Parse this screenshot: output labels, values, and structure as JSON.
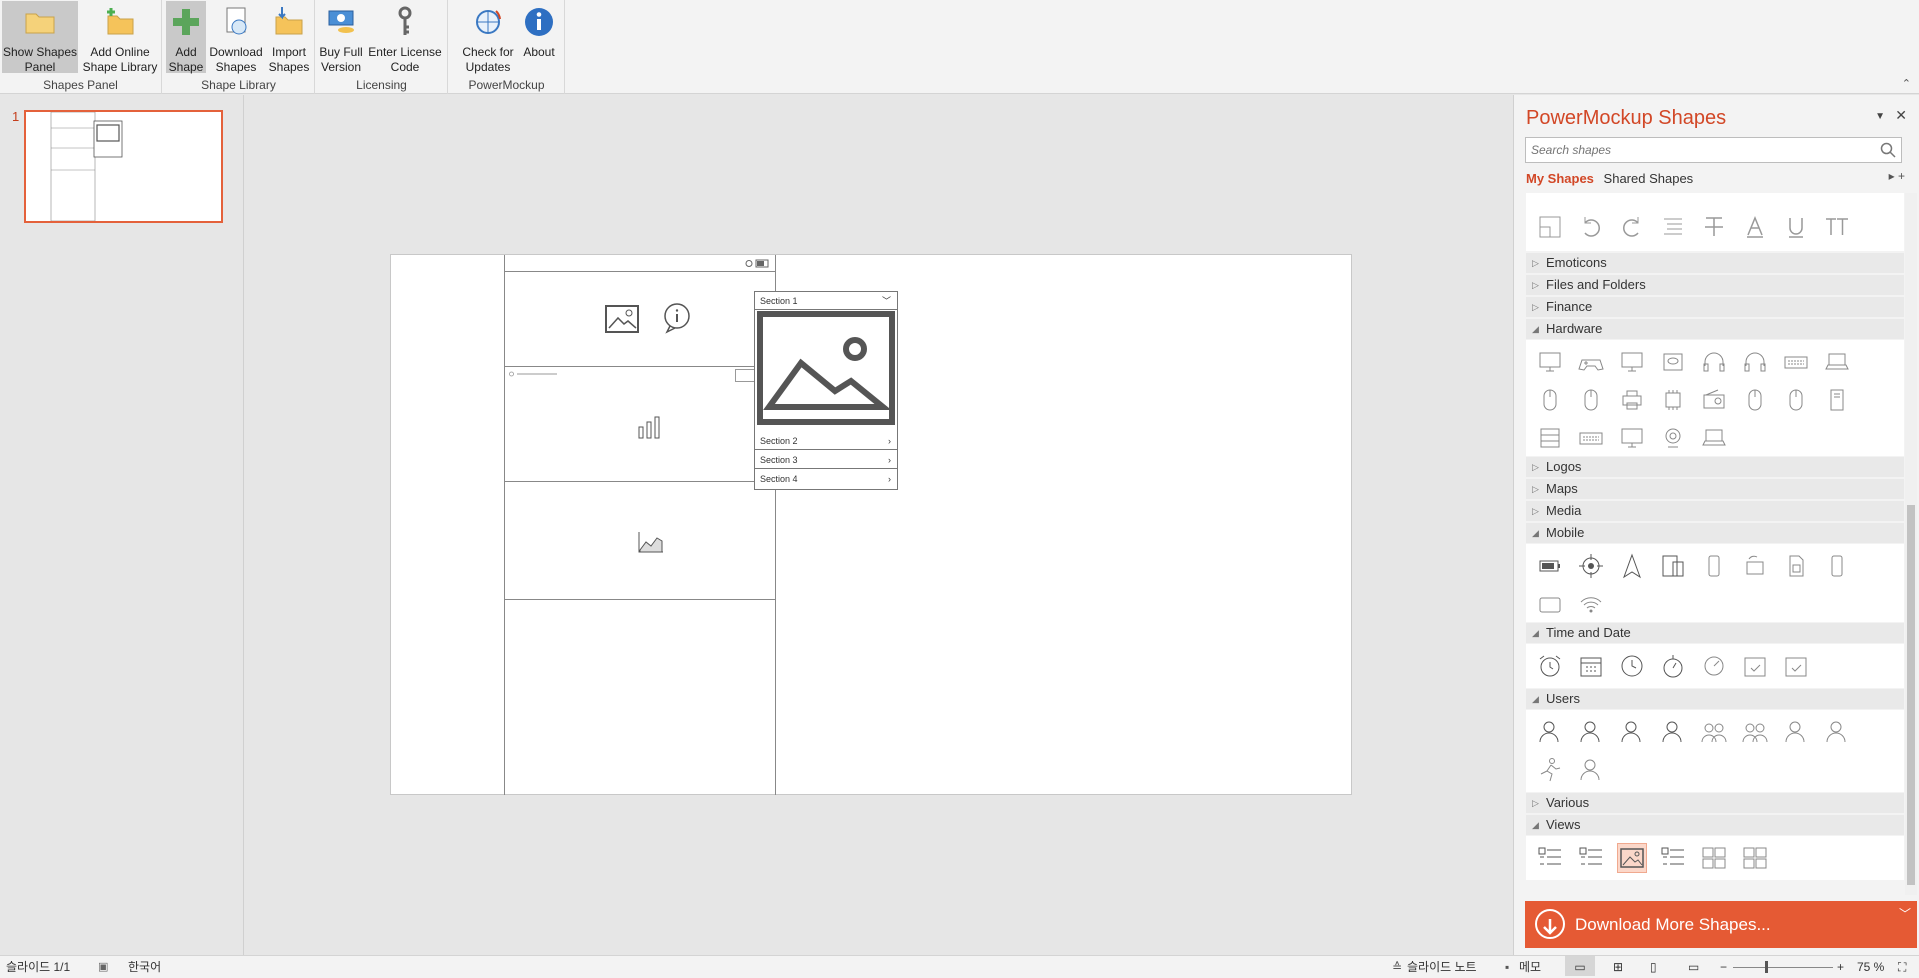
{
  "ribbon": {
    "groups": [
      {
        "label": "Shapes Panel"
      },
      {
        "label": "Shape Library"
      },
      {
        "label": "Licensing"
      },
      {
        "label": "PowerMockup"
      }
    ],
    "buttons": {
      "show_shapes_panel": "Show Shapes Panel",
      "add_online": "Add Online Shape Library",
      "add_shape": "Add Shape",
      "download_shapes": "Download Shapes",
      "import_shapes": "Import Shapes",
      "buy_full": "Buy Full Version",
      "enter_license": "Enter License Code",
      "check_updates": "Check for Updates",
      "about": "About"
    }
  },
  "thumbnails": {
    "number": "1"
  },
  "slide": {
    "accordion": {
      "section1": "Section 1",
      "section2": "Section 2",
      "section3": "Section 3",
      "section4": "Section 4"
    }
  },
  "panel": {
    "title": "PowerMockup Shapes",
    "search_placeholder": "Search shapes",
    "tabs": {
      "my_shapes": "My Shapes",
      "shared_shapes": "Shared Shapes"
    },
    "categories": {
      "emoticons": "Emoticons",
      "files": "Files and Folders",
      "finance": "Finance",
      "hardware": "Hardware",
      "logos": "Logos",
      "maps": "Maps",
      "media": "Media",
      "mobile": "Mobile",
      "time": "Time and Date",
      "users": "Users",
      "various": "Various",
      "views": "Views"
    },
    "download_more": "Download More Shapes..."
  },
  "status": {
    "slide_count": "슬라이드 1/1",
    "language": "한국어",
    "notes": "슬라이드 노트",
    "comments": "메모",
    "zoom": "75 %"
  },
  "colors": {
    "accent": "#d24726",
    "download_bg": "#e55a34"
  }
}
